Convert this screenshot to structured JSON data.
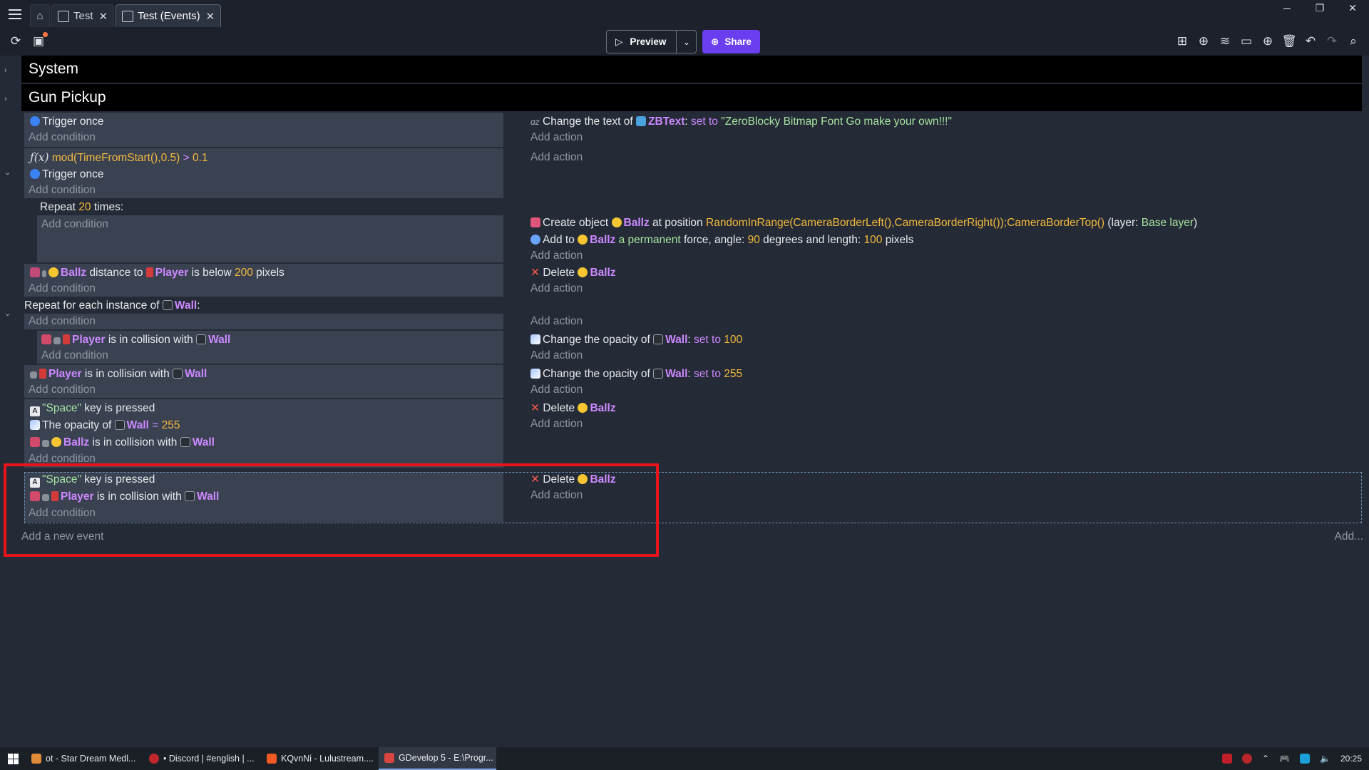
{
  "tabs": [
    {
      "label": "Test"
    },
    {
      "label": "Test (Events)"
    }
  ],
  "window_controls": {
    "minimize": "─",
    "restore": "❐",
    "close": "✕"
  },
  "toolbar": {
    "preview_label": "Preview",
    "share_label": "Share"
  },
  "groups": [
    "System",
    "Gun Pickup"
  ],
  "events": {
    "e1": {
      "cond1": "Trigger once",
      "add_condition": "Add condition",
      "act1_prefix": "Change the text of",
      "act1_obj": "ZBText",
      "act1_mid": "set to",
      "act1_value": "\"ZeroBlocky Bitmap Font Go make your own!!!\"",
      "add_action": "Add action"
    },
    "e2": {
      "cond1_fn": "mod(TimeFromStart(),0.5)",
      "cond1_op": ">",
      "cond1_val": "0.1",
      "cond2": "Trigger once",
      "add_condition": "Add condition",
      "add_action": "Add action"
    },
    "repeat": {
      "prefix": "Repeat",
      "count": "20",
      "suffix": "times:",
      "add_condition": "Add condition",
      "act1_prefix": "Create object",
      "act1_obj": "Ballz",
      "act1_mid": "at position",
      "act1_expr": "RandomInRange(CameraBorderLeft(),CameraBorderRight());CameraBorderTop()",
      "act1_layer_label": "(layer:",
      "act1_layer": "Base layer",
      "act1_end": ")",
      "act2_prefix": "Add to",
      "act2_obj": "Ballz",
      "act2_kw": "a permanent",
      "act2_mid": "force, angle:",
      "act2_angle": "90",
      "act2_mid2": "degrees and length:",
      "act2_len": "100",
      "act2_end": "pixels",
      "add_action": "Add action"
    },
    "e3": {
      "obj1": "Ballz",
      "mid": "distance to",
      "obj2": "Player",
      "mid2": "is below",
      "val": "200",
      "end": "pixels",
      "add_condition": "Add condition",
      "act1_prefix": "Delete",
      "act1_obj": "Ballz",
      "add_action": "Add action"
    },
    "foreach": {
      "prefix": "Repeat for each instance of",
      "obj": "Wall",
      "suffix": ":",
      "add_condition": "Add condition",
      "add_action": "Add action"
    },
    "e4": {
      "obj1": "Player",
      "mid": "is in collision with",
      "obj2": "Wall",
      "add_condition": "Add condition",
      "act1_prefix": "Change the opacity of",
      "act1_obj": "Wall",
      "act1_mid": "set to",
      "act1_val": "100",
      "add_action": "Add action"
    },
    "e5": {
      "obj1": "Player",
      "mid": "is in collision with",
      "obj2": "Wall",
      "add_condition": "Add condition",
      "act1_prefix": "Change the opacity of",
      "act1_obj": "Wall",
      "act1_mid": "set to",
      "act1_val": "255",
      "add_action": "Add action"
    },
    "e6": {
      "cond1_key": "\"Space\"",
      "cond1_end": "key is pressed",
      "cond2_prefix": "The opacity of",
      "cond2_obj": "Wall",
      "cond2_op": "=",
      "cond2_val": "255",
      "cond3_obj": "Ballz",
      "cond3_mid": "is in collision with",
      "cond3_obj2": "Wall",
      "add_condition": "Add condition",
      "act1_prefix": "Delete",
      "act1_obj": "Ballz",
      "add_action": "Add action"
    },
    "e7": {
      "cond1_key": "\"Space\"",
      "cond1_end": "key is pressed",
      "cond2_obj": "Player",
      "cond2_mid": "is in collision with",
      "cond2_obj2": "Wall",
      "add_condition": "Add condition",
      "act1_prefix": "Delete",
      "act1_obj": "Ballz",
      "add_action": "Add action"
    }
  },
  "footer": {
    "add_event": "Add a new event",
    "add_more": "Add..."
  },
  "taskbar": {
    "items": [
      {
        "label": "ot - Star Dream Medl..."
      },
      {
        "label": "• Discord | #english | ..."
      },
      {
        "label": "KQvnNi - Lulustream...."
      },
      {
        "label": "GDevelop 5 - E:\\Progr..."
      }
    ],
    "clock": "20:25"
  },
  "colors": {
    "accent": "#6b3ef0",
    "highlight_box": "#e8141b",
    "object": "#cc88ff",
    "number": "#f3b93d",
    "string": "#a6e2a0"
  }
}
